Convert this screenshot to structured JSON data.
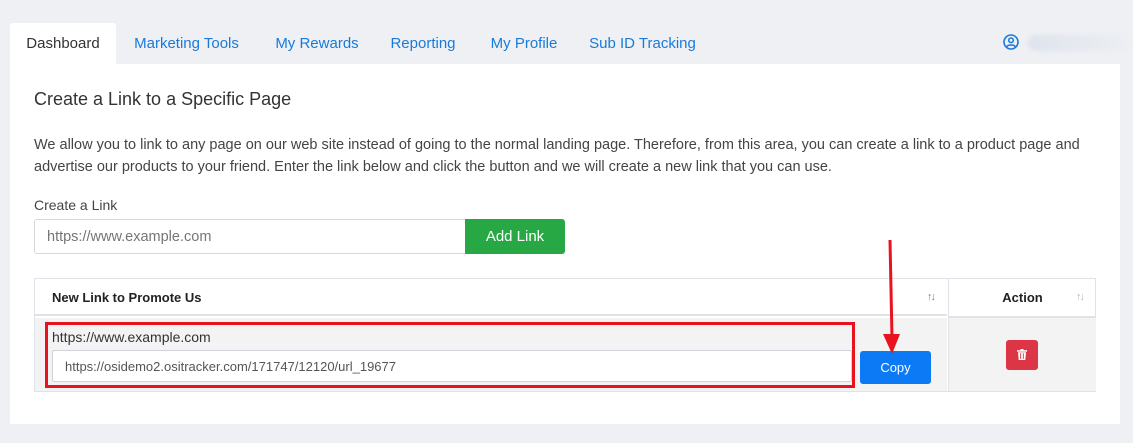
{
  "tabs": [
    {
      "label": "Dashboard",
      "active": true
    },
    {
      "label": "Marketing Tools",
      "active": false
    },
    {
      "label": "My Rewards",
      "active": false
    },
    {
      "label": "Reporting",
      "active": false
    },
    {
      "label": "My Profile",
      "active": false
    },
    {
      "label": "Sub ID Tracking",
      "active": false
    }
  ],
  "user": {
    "icon": "user-circle-icon"
  },
  "page": {
    "title": "Create a Link to a Specific Page",
    "intro": "We allow you to link to any page on our web site instead of going to the normal landing page. Therefore, from this area, you can create a link to a product page and advertise our products to your friend. Enter the link below and click the button and we will create a new link that you can use."
  },
  "form": {
    "label": "Create a Link",
    "placeholder": "https://www.example.com",
    "button": "Add Link"
  },
  "table": {
    "headers": {
      "link": "New Link to Promote Us",
      "action": "Action"
    },
    "rows": [
      {
        "original_url": "https://www.example.com",
        "tracking_url": "https://osidemo2.ositracker.com/171747/12120/url_19677",
        "copy_label": "Copy"
      }
    ]
  },
  "colors": {
    "accent": "#1a7ad9",
    "success": "#28a745",
    "primary": "#0d7af5",
    "danger": "#dc3545",
    "annotation": "#e8131f"
  }
}
